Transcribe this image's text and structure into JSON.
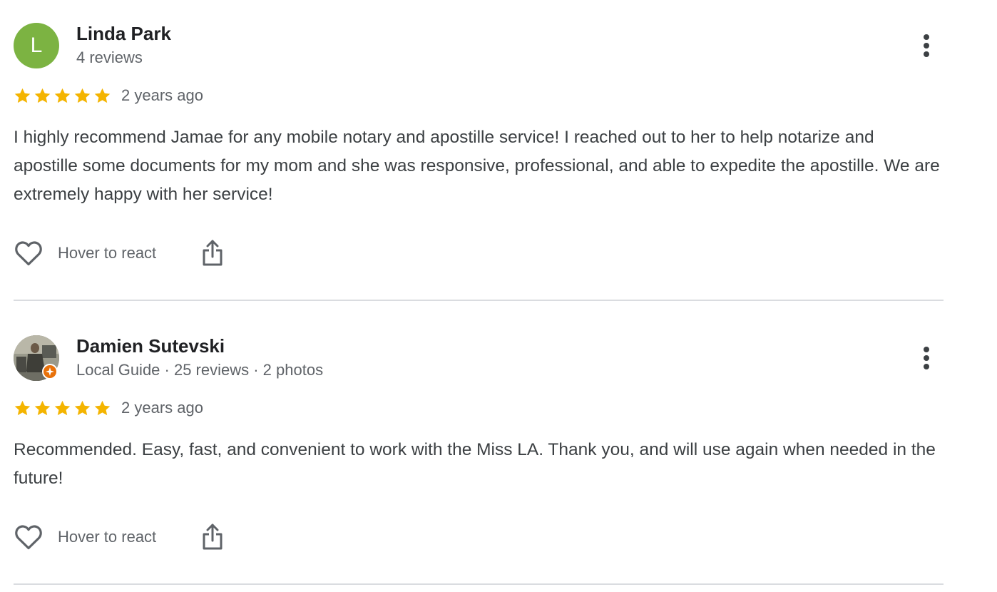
{
  "colors": {
    "star": "#f4b400",
    "avatar_letter_bg": "#7cb342",
    "local_guide_badge": "#e8710a",
    "divider": "#dadce0"
  },
  "reviews": [
    {
      "avatar_letter": "L",
      "name": "Linda Park",
      "meta": "4 reviews",
      "rating": 5,
      "date": "2 years ago",
      "text": "I highly recommend Jamae for any mobile notary and apostille service! I reached out to her to help notarize and apostille some documents for my mom and she was responsive, professional, and able to expedite the apostille. We are extremely happy with her service!",
      "react_label": "Hover to react"
    },
    {
      "avatar_letter": "",
      "name": "Damien Sutevski",
      "meta": "Local Guide · 25 reviews · 2 photos",
      "rating": 5,
      "date": "2 years ago",
      "text": "Recommended. Easy, fast, and convenient to work with the Miss LA. Thank you, and will use again when needed in the future!",
      "react_label": "Hover to react"
    }
  ],
  "icons": {
    "more": "more-vert-icon",
    "react": "heart-outline-icon",
    "share": "share-icon",
    "star": "star-icon",
    "local_guide": "local-guide-badge-icon"
  }
}
